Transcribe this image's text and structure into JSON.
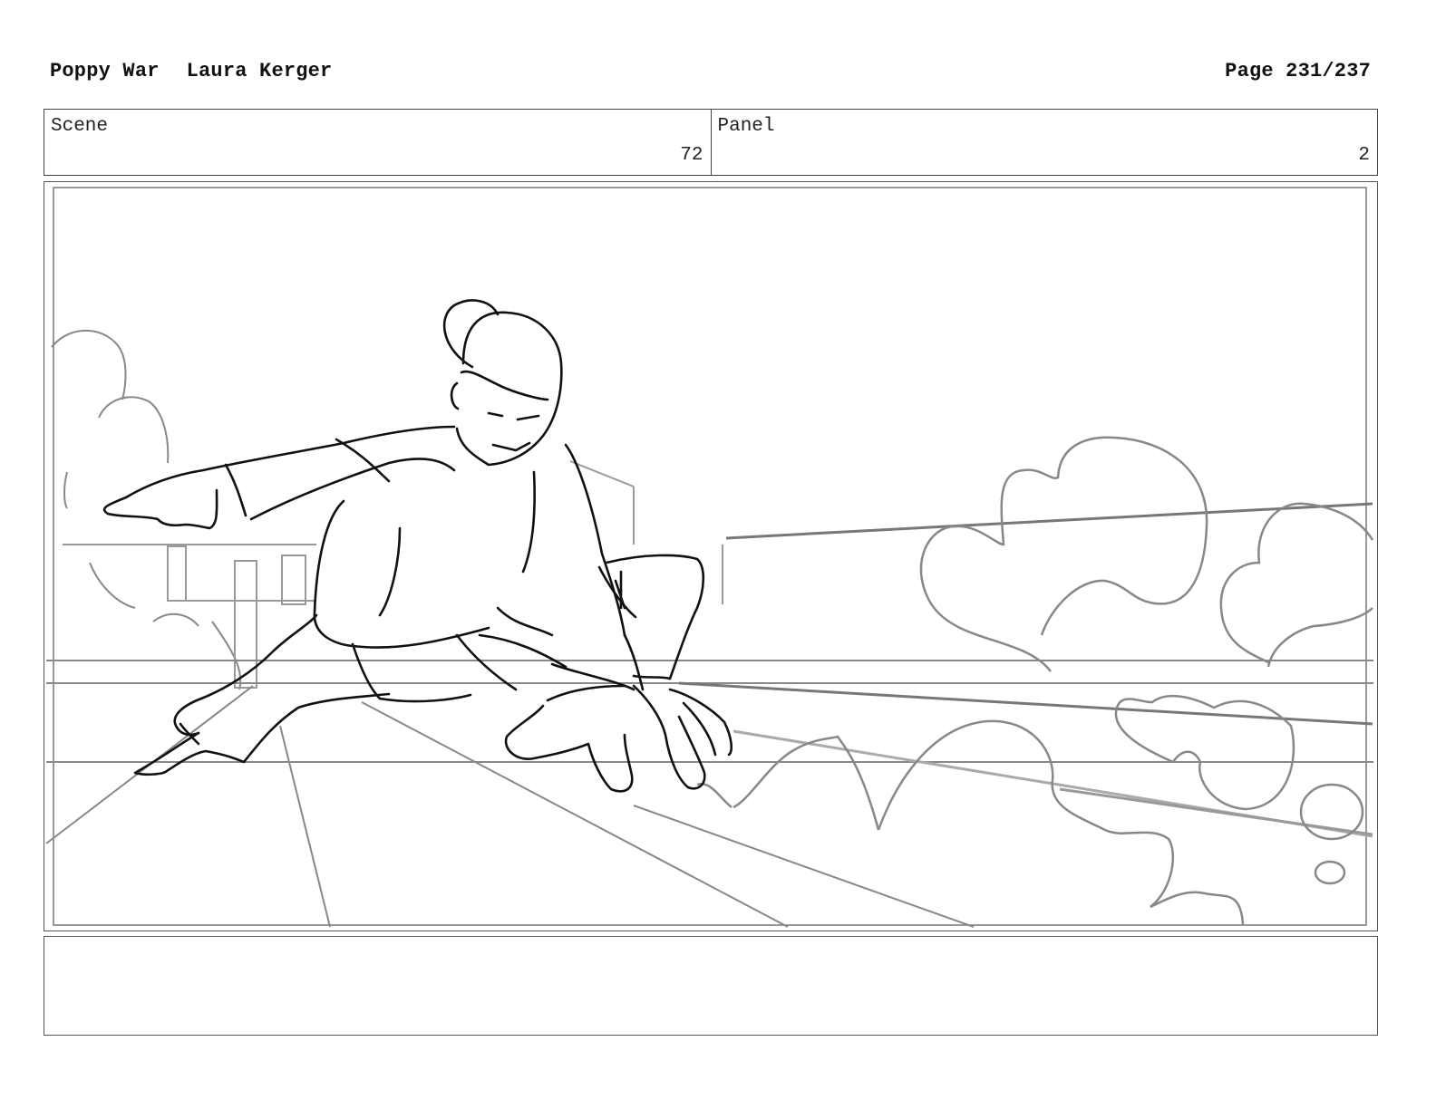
{
  "header": {
    "project": "Poppy War",
    "artist": "Laura Kerger",
    "page": "Page 231/237"
  },
  "info": {
    "scene_label": "Scene",
    "scene_value": "72",
    "panel_label": "Panel",
    "panel_value": "2"
  },
  "notes": {
    "text": ""
  }
}
